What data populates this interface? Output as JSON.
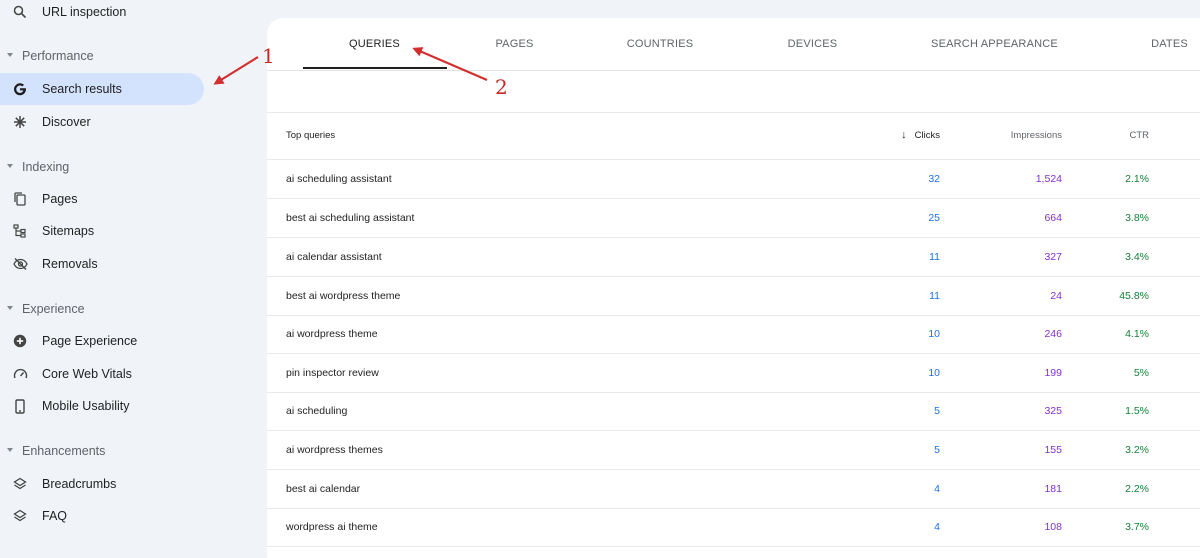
{
  "sidebar": {
    "url_inspection": "URL inspection",
    "sections": {
      "performance": "Performance",
      "indexing": "Indexing",
      "experience": "Experience",
      "enhancements": "Enhancements"
    },
    "items": {
      "search_results": "Search results",
      "discover": "Discover",
      "pages": "Pages",
      "sitemaps": "Sitemaps",
      "removals": "Removals",
      "page_experience": "Page Experience",
      "core_web_vitals": "Core Web Vitals",
      "mobile_usability": "Mobile Usability",
      "breadcrumbs": "Breadcrumbs",
      "faq": "FAQ"
    },
    "active_item": "search_results"
  },
  "tabs": [
    "QUERIES",
    "PAGES",
    "COUNTRIES",
    "DEVICES",
    "SEARCH APPEARANCE",
    "DATES"
  ],
  "active_tab": "QUERIES",
  "table": {
    "headers": {
      "query": "Top queries",
      "clicks": "Clicks",
      "impressions": "Impressions",
      "ctr": "CTR"
    },
    "sort_column": "Clicks",
    "sort_direction": "descending",
    "rows": [
      {
        "query": "ai scheduling assistant",
        "clicks": "32",
        "impressions": "1,524",
        "ctr": "2.1%"
      },
      {
        "query": "best ai scheduling assistant",
        "clicks": "25",
        "impressions": "664",
        "ctr": "3.8%"
      },
      {
        "query": "ai calendar assistant",
        "clicks": "11",
        "impressions": "327",
        "ctr": "3.4%"
      },
      {
        "query": "best ai wordpress theme",
        "clicks": "11",
        "impressions": "24",
        "ctr": "45.8%"
      },
      {
        "query": "ai wordpress theme",
        "clicks": "10",
        "impressions": "246",
        "ctr": "4.1%"
      },
      {
        "query": "pin inspector review",
        "clicks": "10",
        "impressions": "199",
        "ctr": "5%"
      },
      {
        "query": "ai scheduling",
        "clicks": "5",
        "impressions": "325",
        "ctr": "1.5%"
      },
      {
        "query": "ai wordpress themes",
        "clicks": "5",
        "impressions": "155",
        "ctr": "3.2%"
      },
      {
        "query": "best ai calendar",
        "clicks": "4",
        "impressions": "181",
        "ctr": "2.2%"
      },
      {
        "query": "wordpress ai theme",
        "clicks": "4",
        "impressions": "108",
        "ctr": "3.7%"
      }
    ]
  },
  "annotations": {
    "label_1": "1",
    "label_2": "2",
    "color": "#c62828"
  },
  "colors": {
    "clicks": "#1a73e8",
    "impressions": "#8430ce",
    "ctr": "#188038",
    "active_nav_bg": "#d3e3fd"
  },
  "icons": {
    "url_inspection": "search-icon",
    "search_results": "google-g-icon",
    "discover": "asterisk-icon",
    "pages": "pages-icon",
    "sitemaps": "sitemap-icon",
    "removals": "eye-off-icon",
    "page_experience": "plus-circle-icon",
    "core_web_vitals": "gauge-icon",
    "mobile_usability": "phone-icon",
    "breadcrumbs": "layers-icon",
    "faq": "layers-icon"
  }
}
